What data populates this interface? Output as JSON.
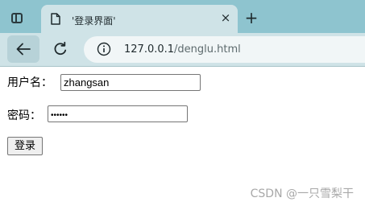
{
  "browser": {
    "tab": {
      "title": "'登录界面'",
      "close_glyph": "×"
    },
    "new_tab_glyph": "+",
    "address": {
      "host": "127.0.0.1",
      "path": "/denglu.html"
    },
    "icons": {
      "sidebar": "sidebar-toggle-icon",
      "page": "page-icon",
      "back": "back-arrow-icon",
      "reload": "reload-icon",
      "info": "info-icon"
    },
    "colors": {
      "tabbar": "#8ec4cf",
      "toolbar": "#cfe3e7"
    }
  },
  "form": {
    "username_label": "用户名：",
    "username_value": "zhangsan",
    "password_label": "密码：",
    "password_masked": "••••••",
    "submit_label": "登录"
  },
  "watermark": "CSDN @一只雪梨干"
}
